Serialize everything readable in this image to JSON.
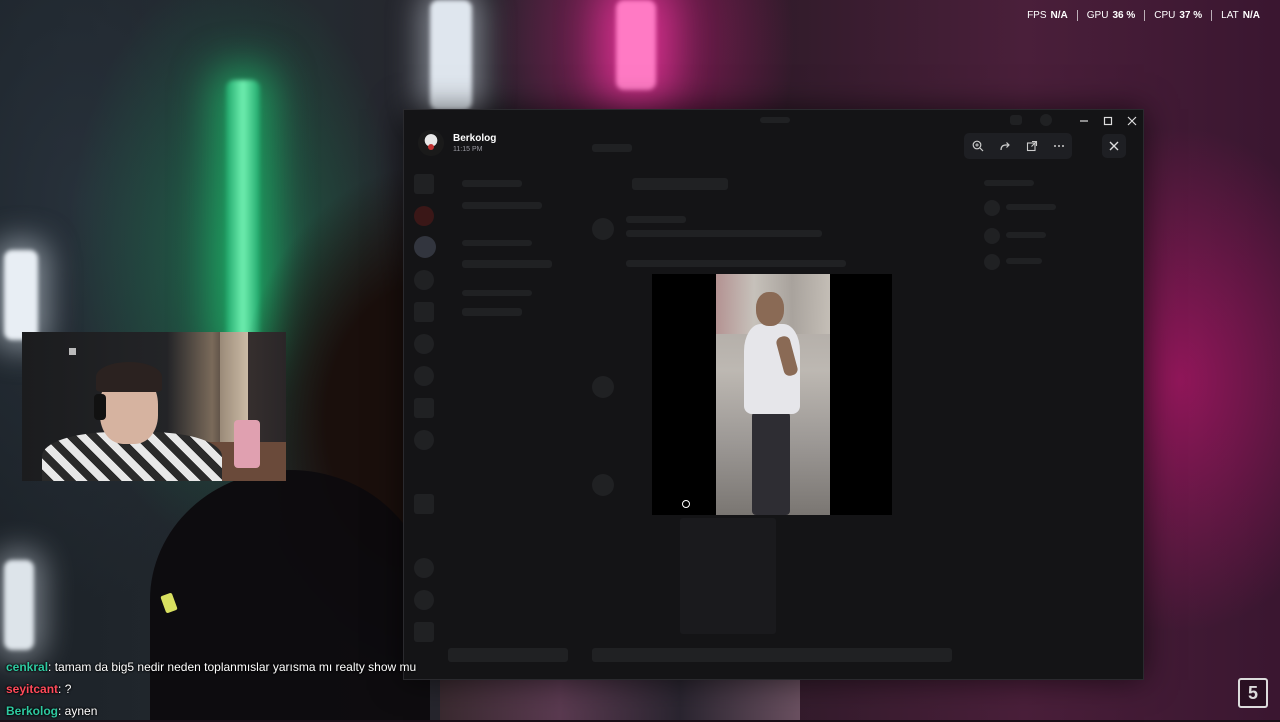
{
  "overlay": {
    "stats": [
      {
        "label": "FPS",
        "value": "N/A"
      },
      {
        "label": "GPU",
        "value": "36 %"
      },
      {
        "label": "CPU",
        "value": "37 %"
      },
      {
        "label": "LAT",
        "value": "N/A"
      }
    ]
  },
  "chat": [
    {
      "user": "cenkral",
      "color": "#2ec9a0",
      "message": ": tamam da big5 nedir neden toplanmıslar yarısma mı realty show mu"
    },
    {
      "user": "seyitcant",
      "color": "#ff4a5a",
      "message": ": ?"
    },
    {
      "user": "Berkolog",
      "color": "#2ec9a0",
      "message": ": aynen"
    }
  ],
  "viewer": {
    "author": "Berkolog",
    "timestamp": "11:15 PM"
  },
  "stream_logo": "5"
}
